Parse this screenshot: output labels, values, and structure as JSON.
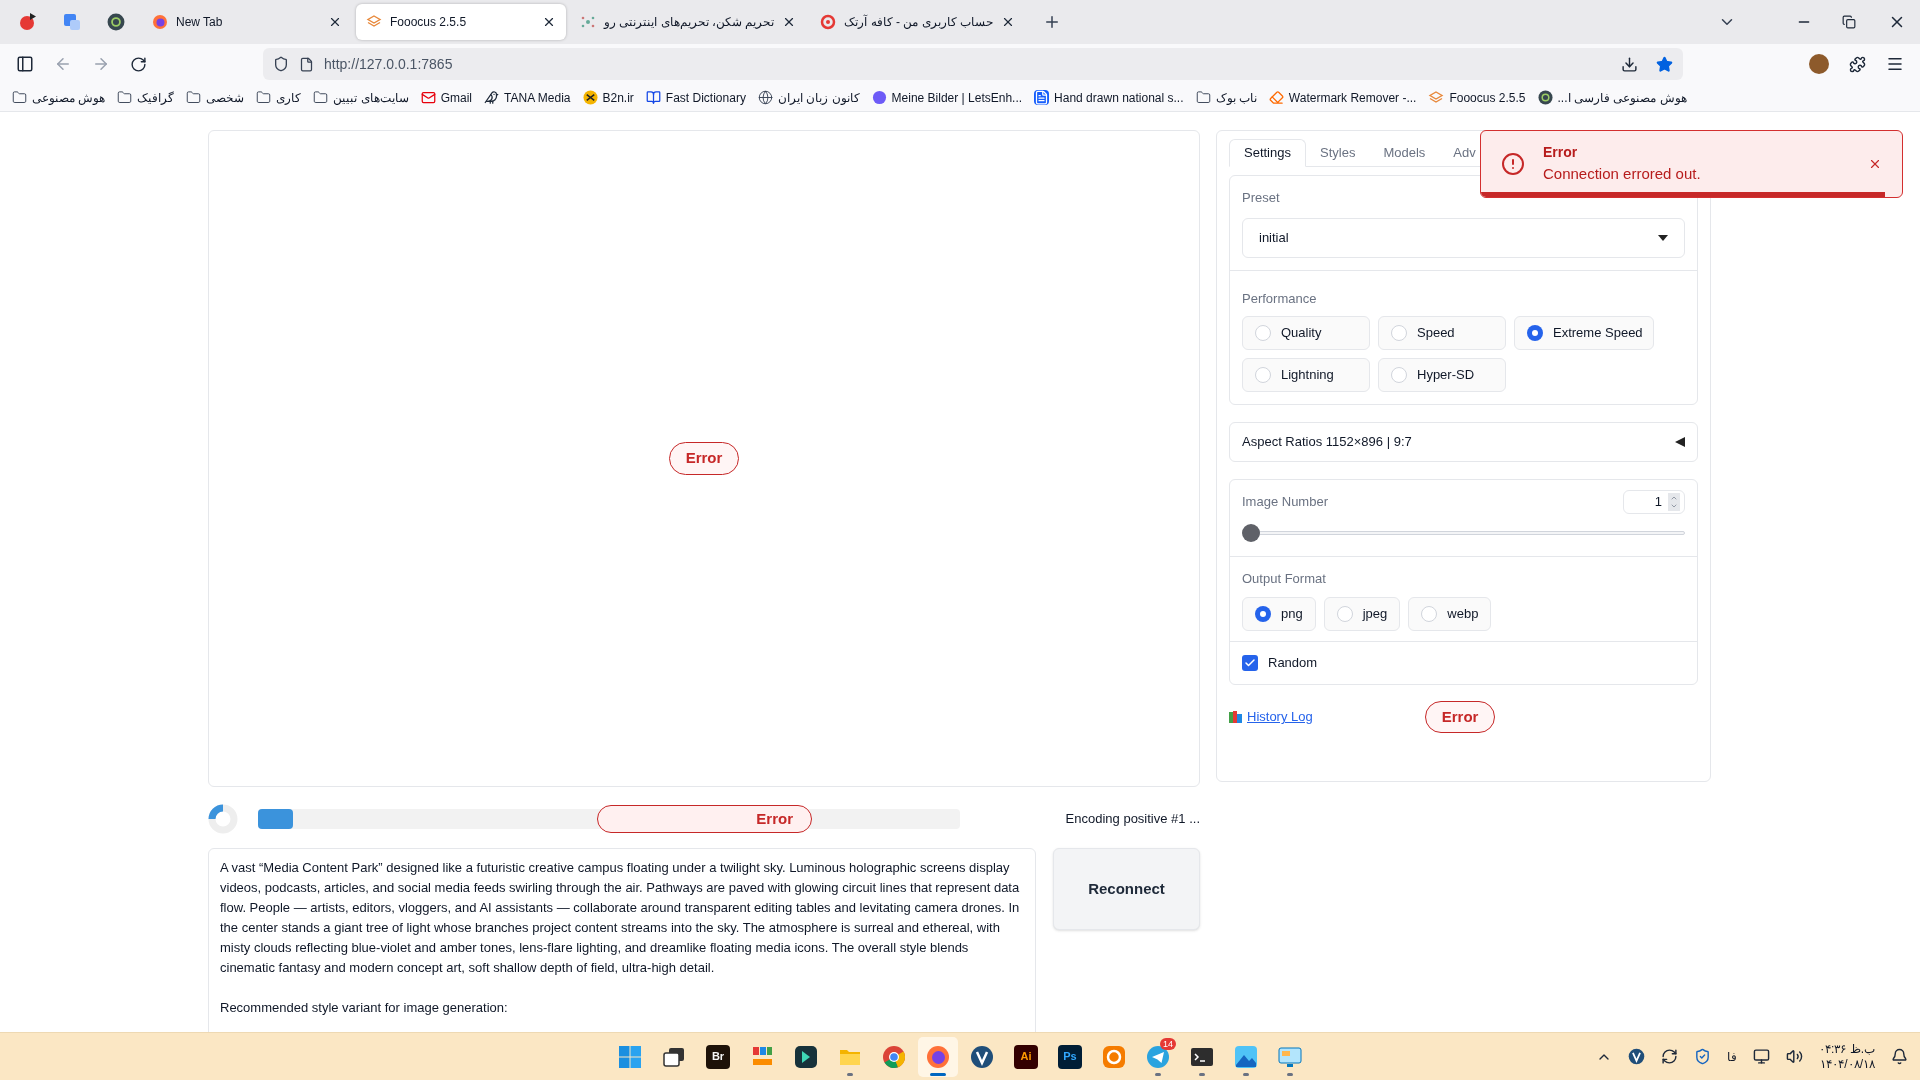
{
  "browser": {
    "tabs": [
      {
        "title": "New Tab",
        "selected": false,
        "kind": "firefox"
      },
      {
        "title": "Fooocus 2.5.5",
        "selected": true,
        "kind": "fooocus"
      },
      {
        "title": "تحریم شکن، تحریم‌های اینترنتی رو",
        "selected": false,
        "kind": "dots"
      },
      {
        "title": "حساب کاربری من - کافه آرتک",
        "selected": false,
        "kind": "ring"
      }
    ],
    "url": "http://127.0.0.1:7865",
    "bookmarks": [
      {
        "title": "هوش مصنوعی",
        "kind": "folder"
      },
      {
        "title": "گرافیک",
        "kind": "folder"
      },
      {
        "title": "شخصی",
        "kind": "folder"
      },
      {
        "title": "کاری",
        "kind": "folder"
      },
      {
        "title": "سایت‌های تبیین",
        "kind": "folder"
      },
      {
        "title": "Gmail",
        "kind": "gmail"
      },
      {
        "title": "TANA Media",
        "kind": "bird"
      },
      {
        "title": "B2n.ir",
        "kind": "b2n"
      },
      {
        "title": "Fast Dictionary",
        "kind": "book"
      },
      {
        "title": "کانون زبان ایران",
        "kind": "globe"
      },
      {
        "title": "Meine Bilder | LetsEnh...",
        "kind": "blob"
      },
      {
        "title": "Hand drawn national s...",
        "kind": "doc"
      },
      {
        "title": "ناب بوک",
        "kind": "folder"
      },
      {
        "title": "Watermark Remover -...",
        "kind": "eraser"
      },
      {
        "title": "Fooocus 2.5.5",
        "kind": "fooocus"
      },
      {
        "title": "هوش مصنوعی فارسی ا...",
        "kind": "circle"
      }
    ]
  },
  "app": {
    "image_area": {
      "error": "Error"
    },
    "progress": {
      "level": 0.05,
      "error": "Error",
      "status": "Encoding positive #1 ..."
    },
    "prompt": {
      "value": "A vast “Media Content Park” designed like a futuristic creative campus floating under a twilight sky. Luminous holographic screens display videos, podcasts, articles, and social media feeds swirling through the air. Pathways are paved with glowing circuit lines that represent data flow. People — artists, editors, vloggers, and AI assistants — collaborate around transparent editing tables and levitating camera drones. In the center stands a giant tree of light whose branches project content streams into the sky. The atmosphere is surreal and ethereal, with misty clouds reflecting blue-violet and amber tones, lens-flare lighting, and dreamlike floating media icons. The overall style blends cinematic fantasy and modern concept art, soft shallow depth of field, ultra-high detail.\n\nRecommended style variant for image generation:"
    },
    "reconnect": "Reconnect",
    "settings": {
      "tabs": [
        {
          "label": "Settings",
          "selected": true
        },
        {
          "label": "Styles",
          "selected": false
        },
        {
          "label": "Models",
          "selected": false
        },
        {
          "label": "Adv",
          "selected": false
        }
      ],
      "preset": {
        "label": "Preset",
        "value": "initial"
      },
      "performance": {
        "label": "Performance",
        "options": [
          {
            "label": "Quality",
            "selected": false
          },
          {
            "label": "Speed",
            "selected": false
          },
          {
            "label": "Extreme Speed",
            "selected": true
          },
          {
            "label": "Lightning",
            "selected": false
          },
          {
            "label": "Hyper-SD",
            "selected": false
          }
        ]
      },
      "aspect_ratios": {
        "label": "Aspect Ratios 1152×896 | 9:7",
        "expanded": false
      },
      "image_number": {
        "label": "Image Number",
        "value": "1",
        "level": 0
      },
      "output_format": {
        "label": "Output Format",
        "options": [
          {
            "label": "png",
            "selected": true
          },
          {
            "label": "jpeg",
            "selected": false
          },
          {
            "label": "webp",
            "selected": false
          }
        ]
      },
      "random": {
        "label": "Random",
        "checked": true
      },
      "history_log": "History Log",
      "error": "Error"
    },
    "toast": {
      "title": "Error",
      "message": "Connection errored out.",
      "level": 0.96
    }
  },
  "taskbar": {
    "apps": [
      {
        "kind": "start",
        "running": false,
        "active": false
      },
      {
        "kind": "taskview",
        "running": false,
        "active": false
      },
      {
        "kind": "tile",
        "label": "Br",
        "running": false,
        "active": false
      },
      {
        "kind": "flook",
        "running": false,
        "active": false
      },
      {
        "kind": "editor",
        "running": false,
        "active": false
      },
      {
        "kind": "folder",
        "running": true,
        "active": false
      },
      {
        "kind": "chrome",
        "running": false,
        "active": false
      },
      {
        "kind": "firefox",
        "running": true,
        "active": true
      },
      {
        "kind": "v",
        "running": false,
        "active": false
      },
      {
        "kind": "tile",
        "label": "Ai",
        "running": false,
        "active": false
      },
      {
        "kind": "tile",
        "label": "Ps",
        "running": false,
        "active": false
      },
      {
        "kind": "e",
        "running": false,
        "active": false
      },
      {
        "kind": "telegram",
        "running": true,
        "active": false,
        "badge": "14"
      },
      {
        "kind": "terminal",
        "running": true,
        "active": false
      },
      {
        "kind": "photos",
        "running": true,
        "active": false
      },
      {
        "kind": "remote",
        "running": true,
        "active": false
      }
    ],
    "tray": {
      "language": "فا",
      "time": "ب.ظ ۰۴:۳۶",
      "date": "۱۴۰۴/۰۸/۱۸"
    }
  }
}
